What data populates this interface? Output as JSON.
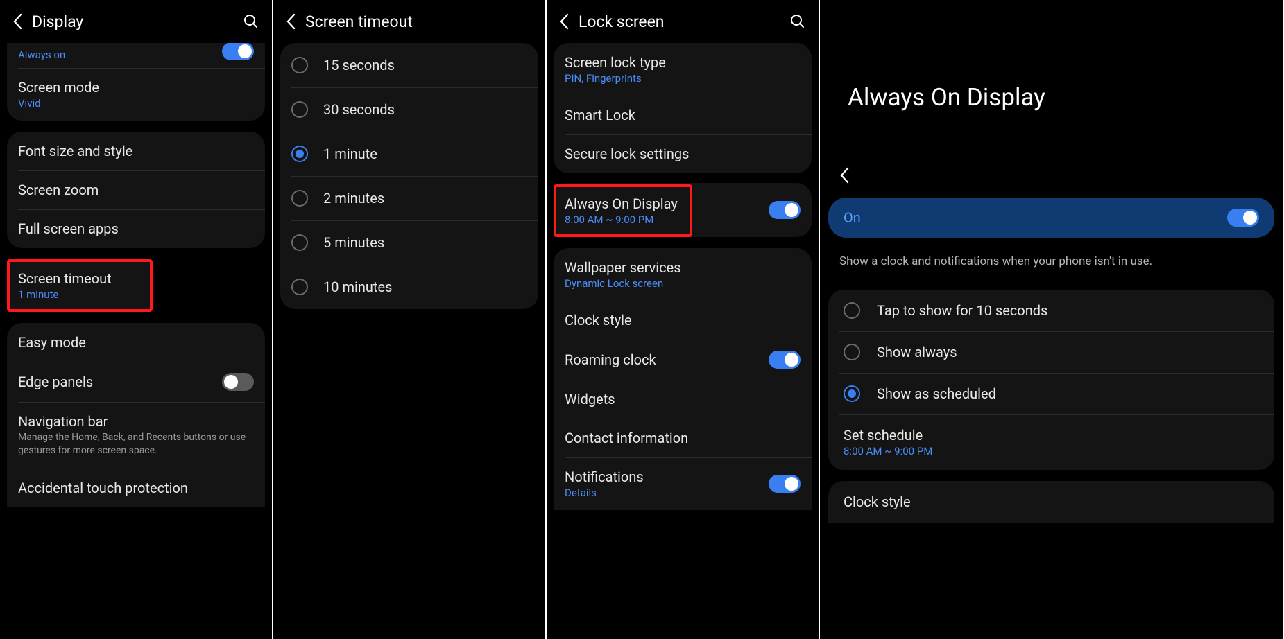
{
  "p1": {
    "title": "Display",
    "alwaysOn": {
      "label": "Always on",
      "on": true
    },
    "screenMode": {
      "label": "Screen mode",
      "sub": "Vivid"
    },
    "fontSize": {
      "label": "Font size and style"
    },
    "screenZoom": {
      "label": "Screen zoom"
    },
    "fullScreenApps": {
      "label": "Full screen apps"
    },
    "screenTimeout": {
      "label": "Screen timeout",
      "sub": "1 minute"
    },
    "easyMode": {
      "label": "Easy mode"
    },
    "edgePanels": {
      "label": "Edge panels",
      "on": false
    },
    "navBar": {
      "label": "Navigation bar",
      "desc": "Manage the Home, Back, and Recents buttons or use gestures for more screen space."
    },
    "touchProtect": {
      "label": "Accidental touch protection"
    }
  },
  "p2": {
    "title": "Screen timeout",
    "options": {
      "o0": "15 seconds",
      "o1": "30 seconds",
      "o2": "1 minute",
      "o3": "2 minutes",
      "o4": "5 minutes",
      "o5": "10 minutes"
    },
    "selectedIndex": 2
  },
  "p3": {
    "title": "Lock screen",
    "lockType": {
      "label": "Screen lock type",
      "sub": "PIN, Fingerprints"
    },
    "smartLock": {
      "label": "Smart Lock"
    },
    "secureLock": {
      "label": "Secure lock settings"
    },
    "aod": {
      "label": "Always On Display",
      "sub": "8:00 AM ~ 9:00 PM",
      "on": true
    },
    "wallpaper": {
      "label": "Wallpaper services",
      "sub": "Dynamic Lock screen"
    },
    "clockStyle": {
      "label": "Clock style"
    },
    "roaming": {
      "label": "Roaming clock",
      "on": true
    },
    "widgets": {
      "label": "Widgets"
    },
    "contact": {
      "label": "Contact information"
    },
    "notifications": {
      "label": "Notifications",
      "sub": "Details",
      "on": true
    }
  },
  "p4": {
    "title": "Always On Display",
    "onLabel": "On",
    "on": true,
    "desc": "Show a clock and notifications when your phone isn't in use.",
    "modes": {
      "m0": "Tap to show for 10 seconds",
      "m1": "Show always",
      "m2": "Show as scheduled"
    },
    "selectedMode": 2,
    "schedule": {
      "label": "Set schedule",
      "sub": "8:00 AM ~ 9:00 PM"
    },
    "clockStyle": {
      "label": "Clock style"
    }
  }
}
